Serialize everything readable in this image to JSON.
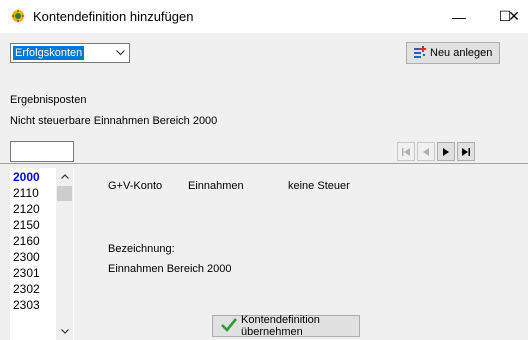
{
  "window": {
    "title": "Kontendefinition hinzufügen",
    "min_glyph": "—",
    "max_glyph": "☐",
    "close_glyph": "✕"
  },
  "toolbar": {
    "account_type_value": "Erfolgskonten",
    "new_button_label": "Neu anlegen"
  },
  "header": {
    "section_label": "Ergebnisposten",
    "description": "Nicht steuerbare Einnahmen Bereich 2000"
  },
  "search": {
    "value": ""
  },
  "accounts": {
    "items": [
      "2000",
      "2110",
      "2120",
      "2150",
      "2160",
      "2300",
      "2301",
      "2302",
      "2303"
    ],
    "selected_index": 0
  },
  "detail": {
    "account_kind": "G+V-Konto",
    "category": "Einnahmen",
    "tax": "keine Steuer",
    "designation_label": "Bezeichnung:",
    "designation_value": "Einnahmen Bereich 2000"
  },
  "actions": {
    "apply_label": "Kontendefinition übernehmen"
  },
  "colors": {
    "selection_blue": "#0078d7",
    "selected_item_text": "#0000ff",
    "check_green": "#2e9c2e"
  },
  "icons": [
    "app-icon",
    "chevron-down-icon",
    "new-record-icon",
    "first-record-icon",
    "previous-record-icon",
    "next-record-icon",
    "last-record-icon",
    "scroll-up-icon",
    "scroll-down-icon",
    "checkmark-icon"
  ]
}
